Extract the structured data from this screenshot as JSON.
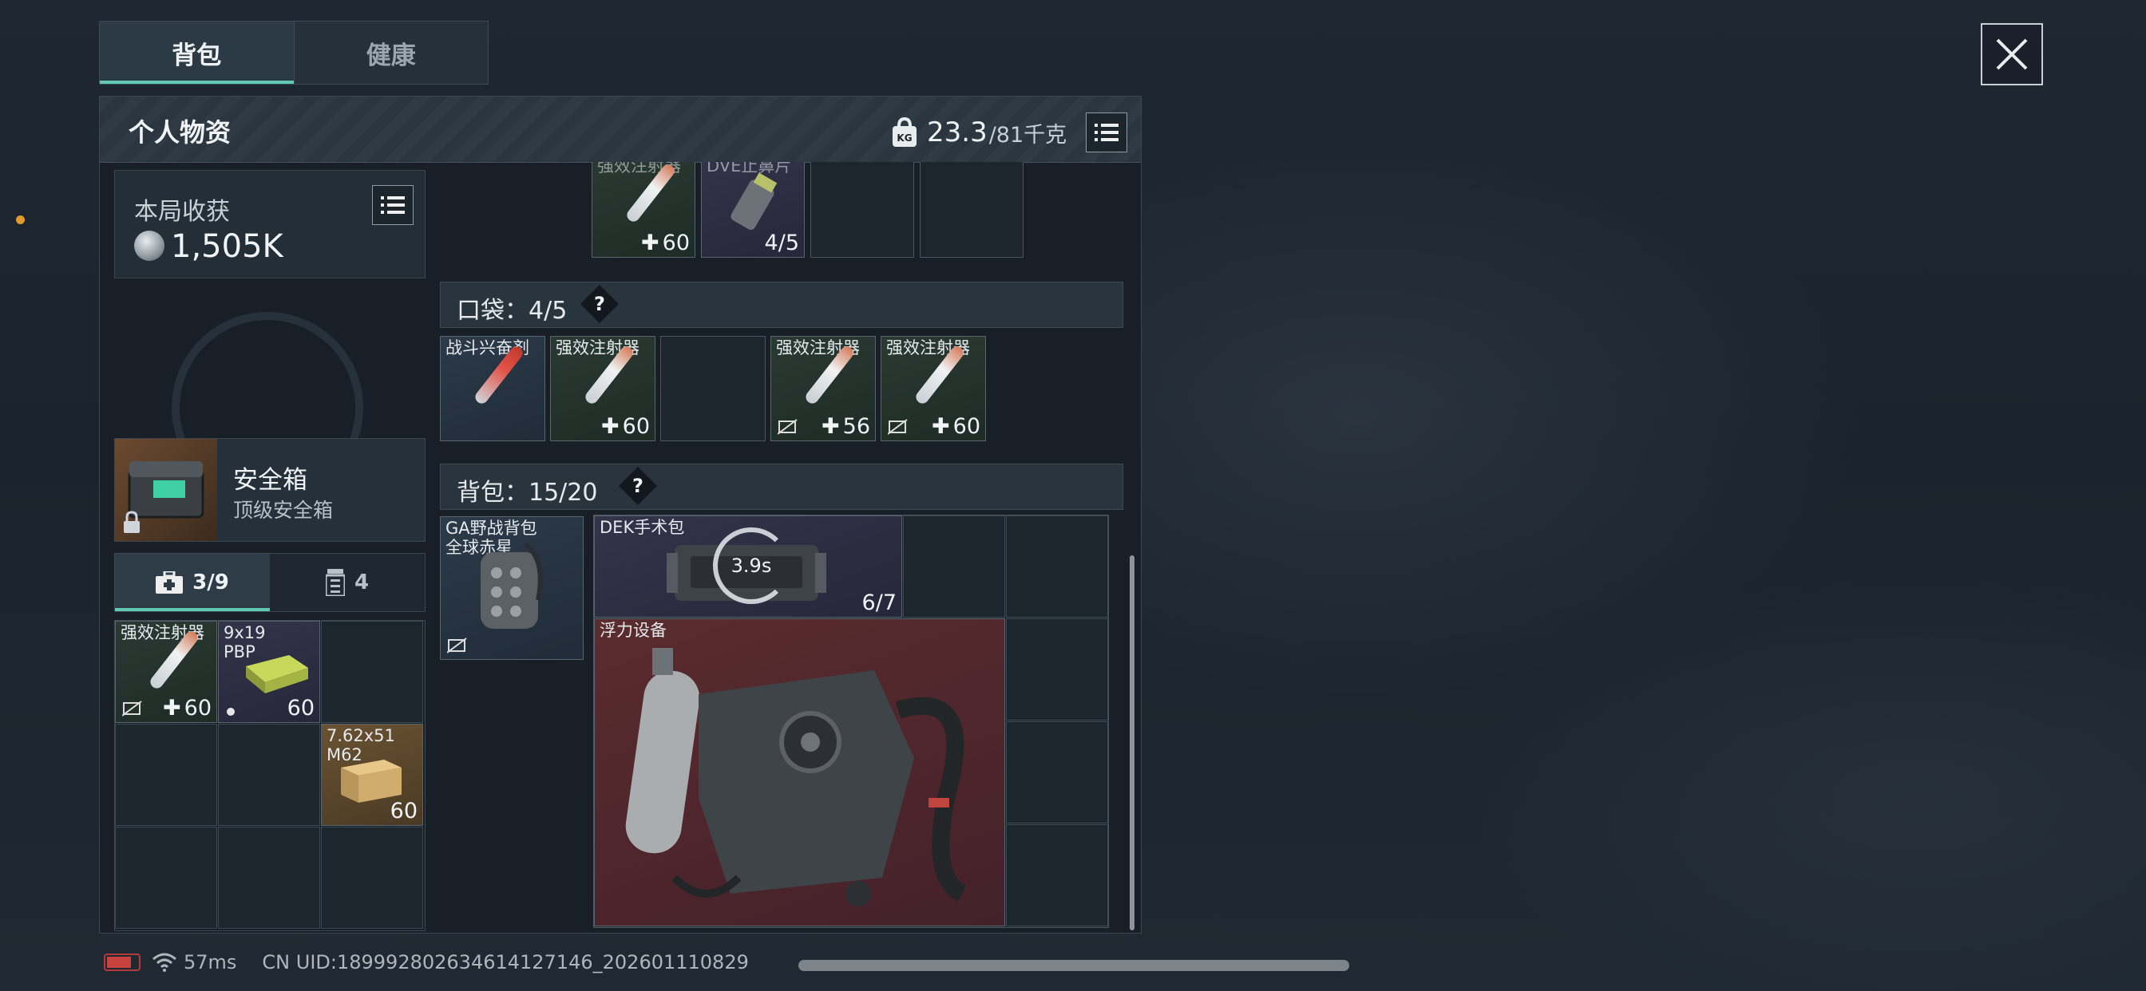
{
  "tabs": [
    {
      "label": "背包",
      "active": true
    },
    {
      "label": "健康",
      "active": false
    }
  ],
  "close_icon": "close-icon",
  "panel": {
    "title": "个人物资",
    "weight_current": "23.3",
    "weight_max": "/81千克",
    "weight_icon": "kg-weight-icon",
    "list_icon": "list-icon"
  },
  "loot": {
    "label": "本局收获",
    "value": "1,505K"
  },
  "safe_box": {
    "title": "安全箱",
    "subtitle": "顶级安全箱"
  },
  "mini_tabs": [
    {
      "icon": "medkit-icon",
      "label": "3/9",
      "active": true
    },
    {
      "icon": "magazine-icon",
      "label": "4",
      "active": false
    }
  ],
  "safe_items": [
    {
      "name": "强效注射器",
      "count": "60",
      "plus": true,
      "no_drop": true
    },
    {
      "name": "9x19\nPBP",
      "count": "60",
      "bullet": true
    },
    {
      "name": "7.62x51\nM62",
      "count": "60"
    }
  ],
  "rig_items": [
    {
      "name": "强效注射器",
      "count": "60",
      "plus": true
    },
    {
      "name": "DVE止鼻片",
      "count": "4/5"
    }
  ],
  "pocket": {
    "label": "口袋：4/5",
    "items": [
      {
        "name": "战斗兴奋剂",
        "count": ""
      },
      {
        "name": "强效注射器",
        "count": "60",
        "plus": true
      },
      {
        "name": "",
        "count": ""
      },
      {
        "name": "强效注射器",
        "count": "56",
        "plus": true,
        "no_drop": true
      },
      {
        "name": "强效注射器",
        "count": "60",
        "plus": true,
        "no_drop": true
      }
    ]
  },
  "backpack": {
    "label": "背包：15/20",
    "bag_name": "GA野战背包\n全球赤星",
    "dek_name": "DEK手术包",
    "dek_timer": "3.9s",
    "dek_count": "6/7",
    "float_name": "浮力设备"
  },
  "status": {
    "ping": "57ms",
    "uid": "CN UID:18999280263461412714​6_202601110829"
  },
  "colors": {
    "accent": "#5fc9b4",
    "marker": "#e29a2d"
  }
}
